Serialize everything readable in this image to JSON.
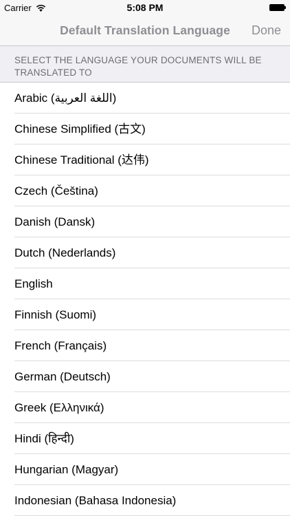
{
  "status_bar": {
    "carrier": "Carrier",
    "time": "5:08 PM"
  },
  "nav": {
    "title": "Default Translation Language",
    "done_label": "Done"
  },
  "section_header": "SELECT THE LANGUAGE YOUR DOCUMENTS WILL BE TRANSLATED TO",
  "languages": [
    "Arabic (اللغة العربية)",
    "Chinese Simplified (古文)",
    "Chinese Traditional (达伟)",
    "Czech (Čeština)",
    "Danish (Dansk)",
    "Dutch (Nederlands)",
    "English",
    "Finnish (Suomi)",
    "French (Français)",
    "German (Deutsch)",
    "Greek (Ελληνικά)",
    "Hindi (हिन्दी)",
    "Hungarian (Magyar)",
    "Indonesian (Bahasa Indonesia)"
  ],
  "colors": {
    "bar_background": "#f7f7f7",
    "nav_text": "#8e8e93",
    "section_background": "#efeff4"
  }
}
